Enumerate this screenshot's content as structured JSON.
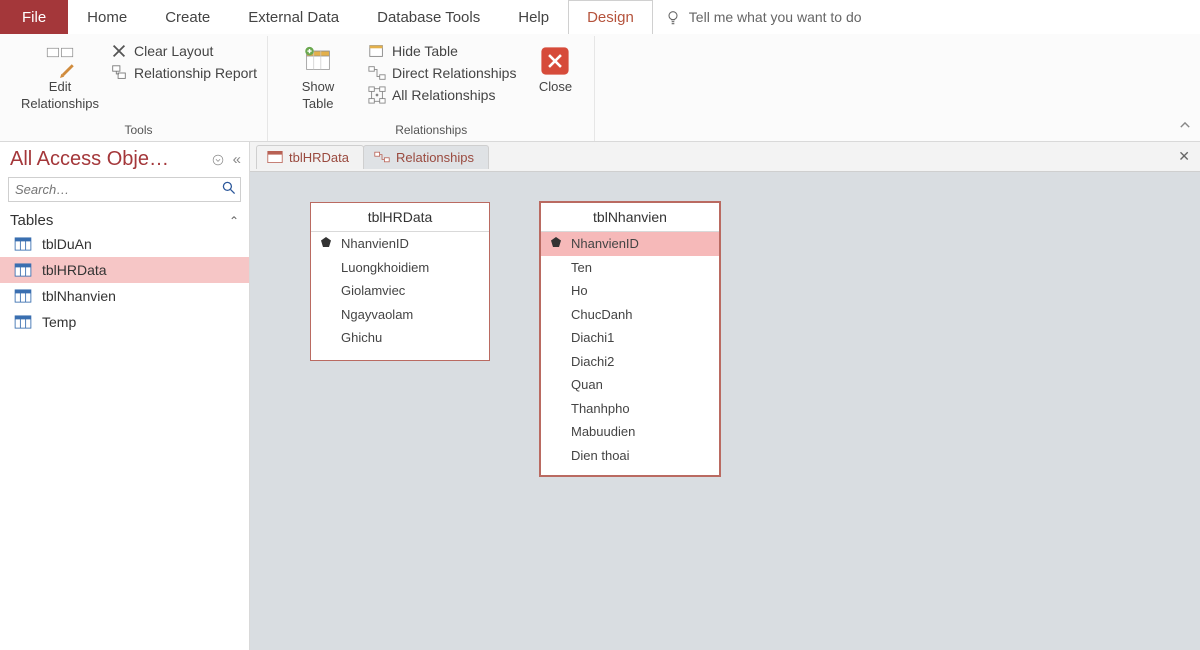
{
  "menu": {
    "file": "File",
    "tabs": [
      "Home",
      "Create",
      "External Data",
      "Database Tools",
      "Help",
      "Design"
    ],
    "active_tab_index": 5,
    "tellme_placeholder": "Tell me what you want to do"
  },
  "ribbon": {
    "groups": {
      "tools": {
        "label": "Tools",
        "edit_relationships_line1": "Edit",
        "edit_relationships_line2": "Relationships",
        "clear_layout": "Clear Layout",
        "relationship_report": "Relationship Report"
      },
      "relationships": {
        "label": "Relationships",
        "show_table_line1": "Show",
        "show_table_line2": "Table",
        "hide_table": "Hide Table",
        "direct_relationships": "Direct Relationships",
        "all_relationships": "All Relationships",
        "close": "Close"
      }
    }
  },
  "nav": {
    "title": "All Access Obje…",
    "search_placeholder": "Search…",
    "section": "Tables",
    "items": [
      {
        "label": "tblDuAn",
        "selected": false
      },
      {
        "label": "tblHRData",
        "selected": true
      },
      {
        "label": "tblNhanvien",
        "selected": false
      },
      {
        "label": "Temp",
        "selected": false
      }
    ]
  },
  "doc_tabs": [
    {
      "label": "tblHRData",
      "kind": "table",
      "active": false
    },
    {
      "label": "Relationships",
      "kind": "relationships",
      "active": true
    }
  ],
  "diagram": {
    "tables": [
      {
        "title": "tblHRData",
        "fields": [
          {
            "name": "NhanvienID",
            "pk": true,
            "selected": false
          },
          {
            "name": "Luongkhoidiem",
            "pk": false,
            "selected": false
          },
          {
            "name": "Giolamviec",
            "pk": false,
            "selected": false
          },
          {
            "name": "Ngayvaolam",
            "pk": false,
            "selected": false
          },
          {
            "name": "Ghichu",
            "pk": false,
            "selected": false
          }
        ]
      },
      {
        "title": "tblNhanvien",
        "fields": [
          {
            "name": "NhanvienID",
            "pk": true,
            "selected": true
          },
          {
            "name": "Ten",
            "pk": false,
            "selected": false
          },
          {
            "name": "Ho",
            "pk": false,
            "selected": false
          },
          {
            "name": "ChucDanh",
            "pk": false,
            "selected": false
          },
          {
            "name": "Diachi1",
            "pk": false,
            "selected": false
          },
          {
            "name": "Diachi2",
            "pk": false,
            "selected": false
          },
          {
            "name": "Quan",
            "pk": false,
            "selected": false
          },
          {
            "name": "Thanhpho",
            "pk": false,
            "selected": false
          },
          {
            "name": "Mabuudien",
            "pk": false,
            "selected": false
          },
          {
            "name": "Dien thoai",
            "pk": false,
            "selected": false
          }
        ]
      }
    ]
  }
}
